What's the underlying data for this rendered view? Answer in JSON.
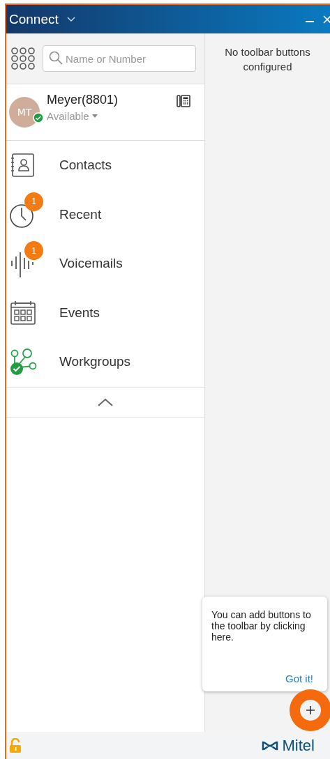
{
  "window": {
    "title": "Connect"
  },
  "search": {
    "placeholder": "Name or Number"
  },
  "user": {
    "initials": "MT",
    "name": "Meyer(8801)",
    "status": "Available",
    "available": true
  },
  "nav": [
    {
      "kind": "contacts",
      "label": "Contacts"
    },
    {
      "kind": "recent",
      "label": "Recent",
      "badge": "1"
    },
    {
      "kind": "voicemails",
      "label": "Voicemails",
      "badge": "1"
    },
    {
      "kind": "events",
      "label": "Events"
    },
    {
      "kind": "workgroups",
      "label": "Workgroups"
    }
  ],
  "toolbar": {
    "message": "No toolbar buttons configured"
  },
  "tip": {
    "text": "You can add buttons to the toolbar by clicking here.",
    "action": "Got it!"
  },
  "footer": {
    "brand": "Mitel"
  }
}
